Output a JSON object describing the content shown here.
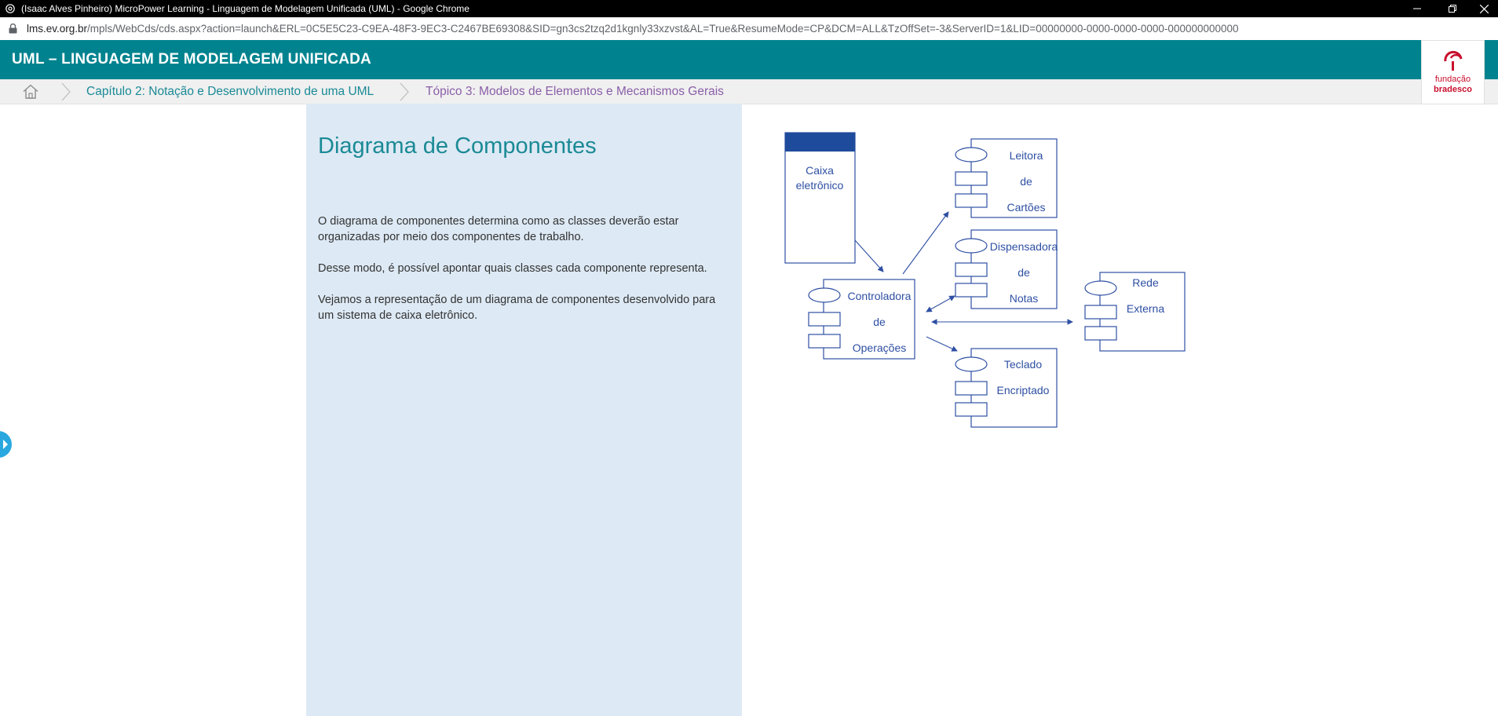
{
  "browser": {
    "window_title": "(Isaac Alves Pinheiro) MicroPower Learning - Linguagem de Modelagem Unificada (UML) - Google Chrome",
    "url_host": "lms.ev.org.br",
    "url_path": "/mpls/WebCds/cds.aspx?action=launch&ERL=0C5E5C23-C9EA-48F3-9EC3-C2467BE69308&SID=gn3cs2tzq2d1kgnly33xzvst&AL=True&ResumeMode=CP&DCM=ALL&TzOffSet=-3&ServerID=1&LID=00000000-0000-0000-0000-000000000000"
  },
  "course": {
    "title": "UML – LINGUAGEM DE MODELAGEM UNIFICADA"
  },
  "breadcrumb": {
    "chapter": "Capítulo 2: Notação e Desenvolvimento de uma UML",
    "topic": "Tópico 3: Modelos de Elementos e Mecanismos Gerais"
  },
  "logo": {
    "line1": "fundação",
    "line2": "bradesco"
  },
  "content": {
    "heading": "Diagrama de Componentes",
    "paragraphs": [
      "O diagrama de componentes determina como as classes deverão estar organizadas por meio dos componentes de trabalho.",
      "Desse modo, é possível apontar quais classes cada componente representa.",
      "Vejamos a representação de um diagrama de componentes desenvolvido para um sistema de caixa eletrônico."
    ]
  },
  "diagram": {
    "atm": [
      "Caixa",
      "eletrônico"
    ],
    "controller": [
      "Controladora",
      "de",
      "Operações"
    ],
    "card_reader": [
      "Leitora",
      "de",
      "Cartões"
    ],
    "dispenser": [
      "Dispensadora",
      "de",
      "Notas"
    ],
    "network": [
      "Rede",
      "Externa"
    ],
    "keypad": [
      "Teclado",
      "Encriptado"
    ]
  },
  "colors": {
    "header_teal": "#00838f",
    "panel_blue": "#dde9f4",
    "diagram_blue": "#2e4fa3",
    "brand_red": "#c8102e"
  }
}
